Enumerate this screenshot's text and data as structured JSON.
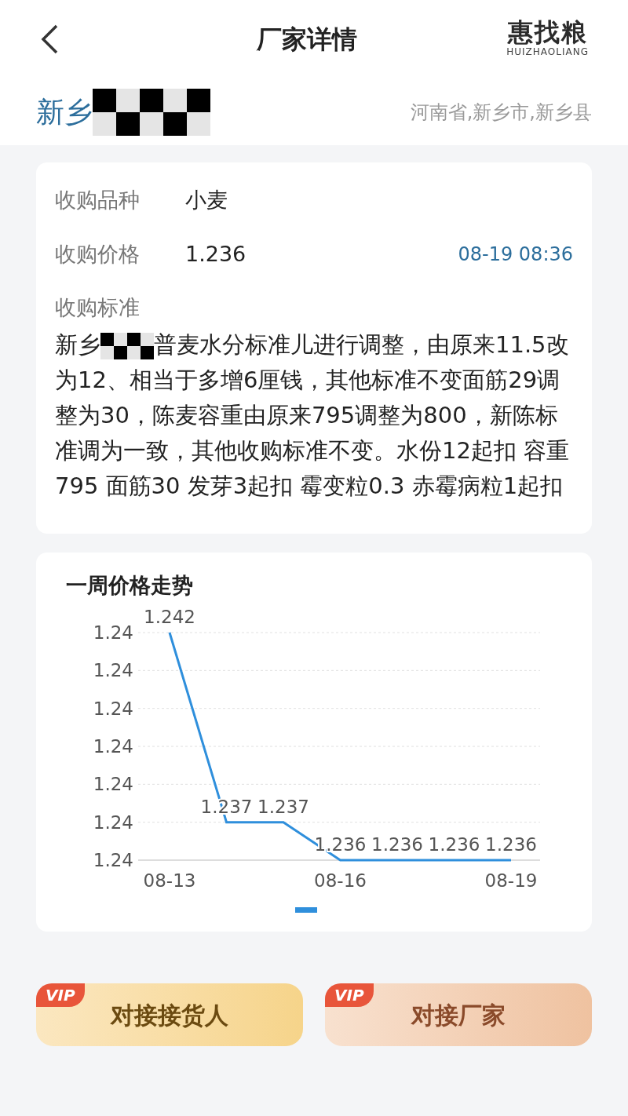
{
  "header": {
    "title": "厂家详情",
    "logo": {
      "name": "惠找粮",
      "subtitle": "HUIZHAOLIANG"
    }
  },
  "factory": {
    "name": "新乡",
    "location": "河南省,新乡市,新乡县"
  },
  "details": [
    {
      "label": "收购品种",
      "value": "小麦"
    },
    {
      "label": "收购价格",
      "value": "1.236",
      "time": "08-19 08:36"
    }
  ],
  "standard": {
    "label": "收购标准",
    "text_before": "新乡",
    "text_after": "普麦水分标准儿进行调整，由原来11.5改为12、相当于多增6厘钱，其他标准不变面筋29调整为30，陈麦容重由原来795调整为800，新陈标准调为一致，其他收购标准不变。水份12起扣 容重795 面筋30 发芽3起扣 霉变粒0.3 赤霉病粒1起扣"
  },
  "trend": {
    "title": "一周价格走势",
    "chart_data": {
      "type": "line",
      "categories": [
        "08-13",
        null,
        null,
        "08-16",
        null,
        null,
        "08-19"
      ],
      "grid": true,
      "ylim": [
        1.236,
        1.242
      ],
      "yticks": [
        {
          "value": 1.242,
          "label": "1.24"
        },
        {
          "value": 1.241,
          "label": "1.24"
        },
        {
          "value": 1.24,
          "label": "1.24"
        },
        {
          "value": 1.239,
          "label": "1.24"
        },
        {
          "value": 1.238,
          "label": "1.24"
        },
        {
          "value": 1.237,
          "label": "1.24"
        },
        {
          "value": 1.236,
          "label": "1.24"
        }
      ],
      "series": [
        {
          "color": "#2f8fdc",
          "values": [
            1.242,
            1.237,
            1.237,
            1.236,
            1.236,
            1.236,
            1.236
          ]
        }
      ],
      "data_labels": true
    }
  },
  "actions": [
    {
      "badge": "VIP",
      "label": "对接接货人",
      "kind": "yellow"
    },
    {
      "badge": "VIP",
      "label": "对接厂家",
      "kind": "peach"
    }
  ]
}
